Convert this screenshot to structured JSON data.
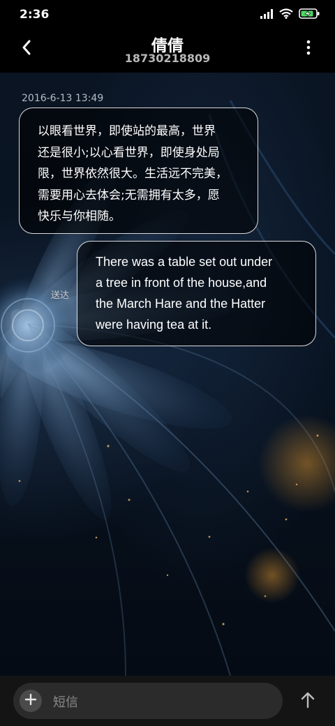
{
  "status_bar": {
    "time": "2:36",
    "icons": [
      "signal-icon",
      "wifi-icon",
      "battery-charging-icon"
    ]
  },
  "header": {
    "contact_name": "倩倩",
    "contact_number": "18730218809",
    "back_icon": "chevron-left-icon",
    "menu_icon": "more-vertical-icon"
  },
  "conversation": {
    "timestamp": "2016-6-13 13:49",
    "messages": [
      {
        "direction": "received",
        "lines": [
          "以眼看世界，即使站的最高，世界",
          "还是很小;以心看世界，即使身处局",
          "限，世界依然很大。生活远不完美，",
          "需要用心去体会;无需拥有太多，愿",
          "快乐与你相随。"
        ]
      },
      {
        "direction": "sent",
        "status": "送达",
        "lines": [
          "There was a table set out under",
          "a tree in front of the house,and",
          "the March Hare and the Hatter",
          "were having tea at it."
        ]
      }
    ]
  },
  "composer": {
    "placeholder": "短信",
    "add_icon": "plus-icon",
    "send_icon": "arrow-up-icon"
  },
  "colors": {
    "bubble_border": "#ffffff",
    "input_bar": "#141414",
    "input_field": "#2b2b2b"
  }
}
